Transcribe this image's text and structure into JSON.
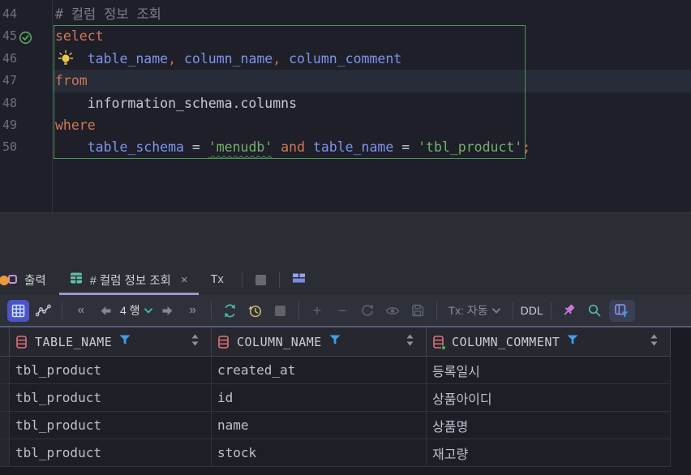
{
  "editor": {
    "lines": [
      {
        "num": "44",
        "comment": "# 컬럼 정보 조회"
      },
      {
        "num": "45",
        "kw": "select"
      },
      {
        "num": "46",
        "indent": "    ",
        "id1": "table_name",
        "c1": ", ",
        "id2": "column_name",
        "c2": ", ",
        "id3": "column_comment"
      },
      {
        "num": "47",
        "kw": "from"
      },
      {
        "num": "48",
        "plain": "    information_schema.columns"
      },
      {
        "num": "49",
        "kw": "where"
      },
      {
        "num": "50",
        "indent": "    ",
        "id1": "table_schema",
        "op1": " = ",
        "s1": "'menudb'",
        "kw": " and ",
        "id2": "table_name",
        "op2": " = ",
        "s2": "'tbl_product'",
        "semi": ";"
      }
    ]
  },
  "result_panel": {
    "tabs": {
      "output": "출력",
      "result": "# 컬럼 정보 조회",
      "close": "×",
      "tx": "Tx"
    },
    "toolbar": {
      "first_page": "«",
      "last_page": "»",
      "page_size": "4 행",
      "add_row": "+",
      "remove_row": "−",
      "tx_mode": "Tx: 자동",
      "ddl": "DDL"
    }
  },
  "table": {
    "headers": [
      "TABLE_NAME",
      "COLUMN_NAME",
      "COLUMN_COMMENT"
    ],
    "rows": [
      [
        "tbl_product",
        "created_at",
        "등록일시"
      ],
      [
        "tbl_product",
        "id",
        "상품아이디"
      ],
      [
        "tbl_product",
        "name",
        "상품명"
      ],
      [
        "tbl_product",
        "stock",
        "재고량"
      ]
    ]
  },
  "icons": {
    "run_success": "check-circle-icon",
    "intention": "lightbulb-icon",
    "output_tab": "console-output-icon",
    "result_tab": "table-grid-icon",
    "header_column": "column-icon",
    "header_filter": "filter-funnel-icon",
    "header_sort": "sort-arrows-icon",
    "view_grid": "grid-view-icon",
    "view_chart": "chart-view-icon",
    "reload": "refresh-icon",
    "history": "history-clock-icon",
    "stop": "stop-square-icon",
    "revert": "revert-icon",
    "preview": "eye-icon",
    "save": "floppy-icon",
    "pin": "pin-icon",
    "find": "search-icon",
    "filter_toggle": "table-filter-icon"
  },
  "colors": {
    "keyword": "#cf7a54",
    "identifier": "#7e93ee",
    "string": "#6fb36a",
    "comment": "#7c8088",
    "selection_frame": "#4f9457",
    "tab_underline": "#a294ce",
    "filter_blue": "#3d9fe8",
    "column_red": "#e2737c",
    "teal": "#49b8a8",
    "history_yellow": "#d4bc6a",
    "pin_magenta": "#c678d6",
    "grid_button_bg": "#4b55c8"
  }
}
